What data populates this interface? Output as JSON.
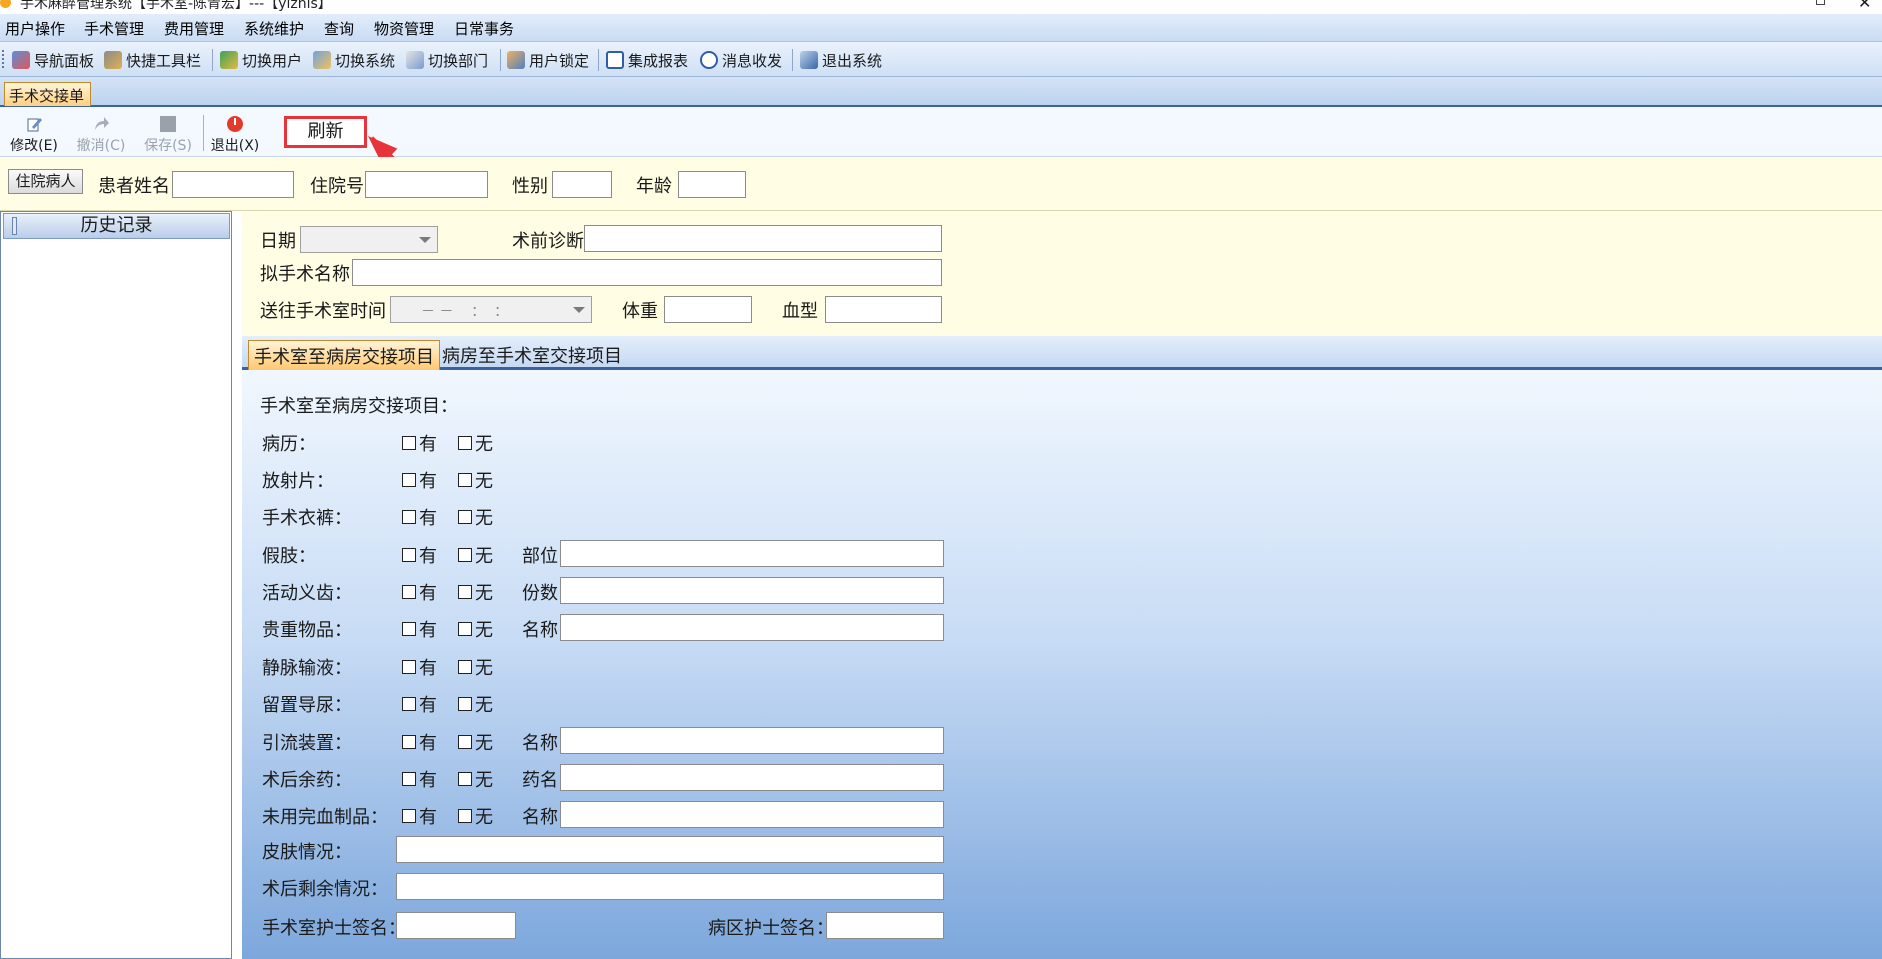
{
  "window": {
    "title": "手术麻醉管理系统【手术室-陈青宏】---【yizhis】"
  },
  "menu": [
    "用户操作",
    "手术管理",
    "费用管理",
    "系统维护",
    "查询",
    "物资管理",
    "日常事务"
  ],
  "toolbar": {
    "items": [
      {
        "label": "导航面板",
        "icon": "navigation-panel-icon"
      },
      {
        "label": "快捷工具栏",
        "icon": "quick-toolbar-icon"
      },
      {
        "label": "切换用户",
        "icon": "switch-user-icon"
      },
      {
        "label": "切换系统",
        "icon": "switch-system-icon"
      },
      {
        "label": "切换部门",
        "icon": "switch-department-icon"
      },
      {
        "label": "用户锁定",
        "icon": "user-lock-icon"
      },
      {
        "label": "集成报表",
        "icon": "report-icon"
      },
      {
        "label": "消息收发",
        "icon": "message-icon"
      },
      {
        "label": "退出系统",
        "icon": "exit-system-icon"
      }
    ]
  },
  "doc_tab": "手术交接单",
  "actions": {
    "edit": "修改(E)",
    "cancel": "撤消(C)",
    "save": "保存(S)",
    "exit": "退出(X)",
    "refresh": "刷新"
  },
  "patient": {
    "inpatient_btn": "住院病人",
    "name_label": "患者姓名",
    "name_value": "",
    "admission_label": "住院号",
    "admission_value": "",
    "gender_label": "性别",
    "gender_value": "",
    "age_label": "年龄",
    "age_value": ""
  },
  "history": {
    "title": "历史记录"
  },
  "form": {
    "date_label": "日期",
    "date_value": "",
    "diagnosis_label": "术前诊断",
    "diagnosis_value": "",
    "surgery_label": "拟手术名称",
    "surgery_value": "",
    "sendtime_label": "送往手术室时间",
    "sendtime_value": "－ －    ：  ：",
    "weight_label": "体重",
    "weight_value": "",
    "blood_label": "血型",
    "blood_value": ""
  },
  "subtabs": [
    "手术室至病房交接项目",
    "病房至手术室交接项目"
  ],
  "handover": {
    "heading": "手术室至病房交接项目：",
    "yes": "有",
    "no": "无",
    "rows": [
      {
        "label": "病历：",
        "extra": ""
      },
      {
        "label": "放射片：",
        "extra": ""
      },
      {
        "label": "手术衣裤：",
        "extra": ""
      },
      {
        "label": "假肢：",
        "extra": "部位"
      },
      {
        "label": "活动义齿：",
        "extra": "份数"
      },
      {
        "label": "贵重物品：",
        "extra": "名称"
      },
      {
        "label": "静脉输液：",
        "extra": ""
      },
      {
        "label": "留置导尿：",
        "extra": ""
      },
      {
        "label": "引流装置：",
        "extra": "名称"
      },
      {
        "label": "术后余药：",
        "extra": "药名"
      },
      {
        "label": "未用完血制品：",
        "extra": "名称"
      }
    ],
    "skin_label": "皮肤情况：",
    "remain_label": "术后剩余情况：",
    "or_nurse_label": "手术室护士签名：",
    "ward_nurse_label": "病区护士签名："
  },
  "colors": {
    "annotation": "#e8333a",
    "tab_active": "#ffc870"
  }
}
